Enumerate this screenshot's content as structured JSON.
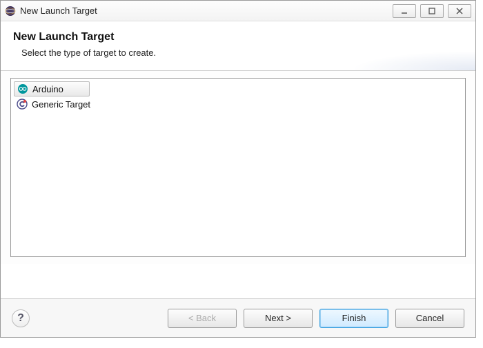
{
  "window": {
    "title": "New Launch Target"
  },
  "header": {
    "title": "New Launch Target",
    "subtitle": "Select the type of target to create."
  },
  "list": {
    "items": [
      {
        "label": "Arduino",
        "icon": "arduino-icon",
        "selected": true
      },
      {
        "label": "Generic Target",
        "icon": "cdt-icon",
        "selected": false
      }
    ]
  },
  "buttons": {
    "back": "< Back",
    "next": "Next >",
    "finish": "Finish",
    "cancel": "Cancel"
  }
}
